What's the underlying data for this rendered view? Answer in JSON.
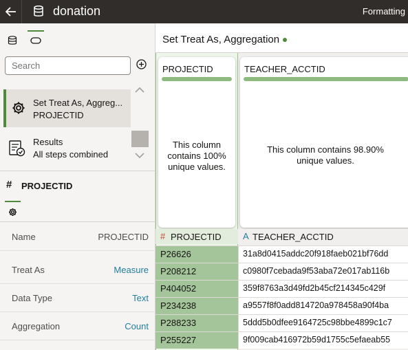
{
  "app": {
    "title": "donation",
    "formatting_label": "Formatting"
  },
  "sidebar": {
    "search_placeholder": "Search",
    "steps": [
      {
        "title": "Set Treat As, Aggreg...",
        "subtitle": "PROJECTID",
        "active": true
      },
      {
        "title": "Results",
        "subtitle": "All steps combined",
        "active": false
      }
    ],
    "column": {
      "type_glyph": "#",
      "name": "PROJECTID"
    },
    "properties": [
      {
        "label": "Name",
        "value": "PROJECTID",
        "editable": false
      },
      {
        "label": "Treat As",
        "value": "Measure",
        "editable": true
      },
      {
        "label": "Data Type",
        "value": "Text",
        "editable": true
      },
      {
        "label": "Aggregation",
        "value": "Count",
        "editable": true
      }
    ]
  },
  "main": {
    "step_header": "Set Treat As, Aggregation",
    "cards": [
      {
        "title": "PROJECTID",
        "description": "This column contains 100% unique values.",
        "unique_pct": 100
      },
      {
        "title": "TEACHER_ACCTID",
        "description": "This column contains 98.90% unique values.",
        "unique_pct": 98.9
      }
    ],
    "columns": [
      {
        "type_glyph": "#",
        "name": "PROJECTID"
      },
      {
        "type_glyph": "A",
        "name": "TEACHER_ACCTID"
      }
    ],
    "rows": [
      [
        "P26626",
        "31a8d0415addc20f918faeb021bf76dd"
      ],
      [
        "P208212",
        "c0980f7cebada9f53aba72e017ab116b"
      ],
      [
        "P404052",
        "359f8763a3d49fd2b45cf214345c429f"
      ],
      [
        "P234238",
        "a9557f8f0add814720a978458a90f4ba"
      ],
      [
        "P288233",
        "5ddd5b0dfee9164725c98bbe4899c1c7"
      ],
      [
        "P255227",
        "9f009cab416972b59d1755c5efaeab55"
      ]
    ]
  },
  "colors": {
    "accent_green": "#4f8a3c",
    "highlight_green": "#a4c59a",
    "link_teal": "#227e9e",
    "topbar": "#312d2a"
  }
}
